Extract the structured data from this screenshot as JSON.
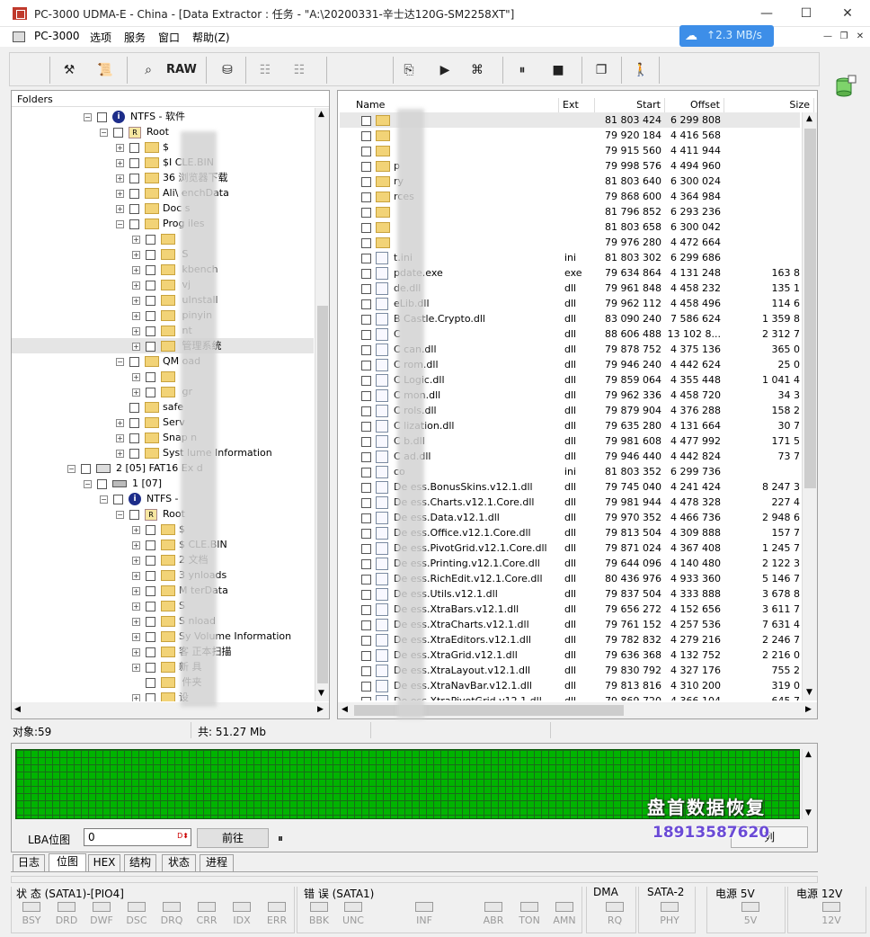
{
  "window": {
    "title": "PC-3000 UDMA-E - China - [Data Extractor : 任务 - \"A:\\20200331-辛士达120G-SM2258XT\"]",
    "net_speed": "2.3 MB/s",
    "minimize": "—",
    "maximize": "☐",
    "close": "✕"
  },
  "menu": [
    "PC-3000",
    "选项",
    "服务",
    "窗口",
    "帮助(Z)"
  ],
  "toolbar": {
    "raw_label": "RAW"
  },
  "folders": {
    "header": "Folders",
    "rows": [
      {
        "indent": 0,
        "exp": "−",
        "icon": "ntfs",
        "label": "NTFS - 软件"
      },
      {
        "indent": 1,
        "exp": "−",
        "icon": "root",
        "label": "Root"
      },
      {
        "indent": 2,
        "exp": "+",
        "icon": "folder",
        "label": "$"
      },
      {
        "indent": 2,
        "exp": "+",
        "icon": "folder",
        "label": "$I      CLE.BIN"
      },
      {
        "indent": 2,
        "exp": "+",
        "icon": "folder",
        "label": "36        浏览器下载"
      },
      {
        "indent": 2,
        "exp": "+",
        "icon": "folder",
        "label": "Ali\\         enchData"
      },
      {
        "indent": 2,
        "exp": "+",
        "icon": "folder",
        "label": "Doc          s"
      },
      {
        "indent": 2,
        "exp": "−",
        "icon": "folder",
        "label": "Prog         iles"
      },
      {
        "indent": 3,
        "exp": "+",
        "icon": "folder",
        "label": ""
      },
      {
        "indent": 3,
        "exp": "+",
        "icon": "folder",
        "label": "          S"
      },
      {
        "indent": 3,
        "exp": "+",
        "icon": "folder",
        "label": "          kbench"
      },
      {
        "indent": 3,
        "exp": "+",
        "icon": "folder",
        "label": "          vj"
      },
      {
        "indent": 3,
        "exp": "+",
        "icon": "folder",
        "label": "          uInstall"
      },
      {
        "indent": 3,
        "exp": "+",
        "icon": "folder",
        "label": "          pinyin"
      },
      {
        "indent": 3,
        "exp": "+",
        "icon": "folder",
        "label": "          nt"
      },
      {
        "indent": 3,
        "exp": "+",
        "icon": "folder",
        "label": "          管理系统",
        "selected": true
      },
      {
        "indent": 2,
        "exp": "−",
        "icon": "folder",
        "label": "QM         oad"
      },
      {
        "indent": 3,
        "exp": "+",
        "icon": "folder",
        "label": ""
      },
      {
        "indent": 3,
        "exp": "+",
        "icon": "folder",
        "label": "          gr"
      },
      {
        "indent": 2,
        "exp": "",
        "icon": "folder",
        "label": "safe"
      },
      {
        "indent": 2,
        "exp": "+",
        "icon": "folder",
        "label": "Serv"
      },
      {
        "indent": 2,
        "exp": "+",
        "icon": "folder",
        "label": "Snap         n"
      },
      {
        "indent": 2,
        "exp": "+",
        "icon": "folder",
        "label": "Syst         lume Information"
      },
      {
        "indent": -1,
        "exp": "−",
        "icon": "part",
        "label": "2 [05] FAT16 Ex          d"
      },
      {
        "indent": 0,
        "exp": "−",
        "icon": "disk",
        "label": "1 [07]"
      },
      {
        "indent": 1,
        "exp": "−",
        "icon": "ntfs",
        "label": "NTFS - "
      },
      {
        "indent": 2,
        "exp": "−",
        "icon": "root",
        "label": "Root"
      },
      {
        "indent": 3,
        "exp": "+",
        "icon": "folder",
        "label": "$          "
      },
      {
        "indent": 3,
        "exp": "+",
        "icon": "folder",
        "label": "$          CLE.BIN"
      },
      {
        "indent": 3,
        "exp": "+",
        "icon": "folder",
        "label": "2          文档"
      },
      {
        "indent": 3,
        "exp": "+",
        "icon": "folder",
        "label": "3          ynloads"
      },
      {
        "indent": 3,
        "exp": "+",
        "icon": "folder",
        "label": "M          terData"
      },
      {
        "indent": 3,
        "exp": "+",
        "icon": "folder",
        "label": "S"
      },
      {
        "indent": 3,
        "exp": "+",
        "icon": "folder",
        "label": "S          nload"
      },
      {
        "indent": 3,
        "exp": "+",
        "icon": "folder",
        "label": "Sy          Volume Information"
      },
      {
        "indent": 3,
        "exp": "+",
        "icon": "folder",
        "label": "客          正本扫描"
      },
      {
        "indent": 3,
        "exp": "+",
        "icon": "folder",
        "label": "新          具"
      },
      {
        "indent": 3,
        "exp": "",
        "icon": "folder",
        "label": "          件夹"
      },
      {
        "indent": 3,
        "exp": "+",
        "icon": "folder",
        "label": "设"
      }
    ]
  },
  "files": {
    "columns": [
      "Name",
      "Ext",
      "Start",
      "Offset",
      "Size"
    ],
    "rows": [
      {
        "type": "folder",
        "name": "",
        "ext": "",
        "start": "81 803 424",
        "offset": "6 299 808",
        "size": ""
      },
      {
        "type": "folder",
        "name": "",
        "ext": "",
        "start": "79 920 184",
        "offset": "4 416 568",
        "size": ""
      },
      {
        "type": "folder",
        "name": "",
        "ext": "",
        "start": "79 915 560",
        "offset": "4 411 944",
        "size": ""
      },
      {
        "type": "folder",
        "name": "                p",
        "ext": "",
        "start": "79 998 576",
        "offset": "4 494 960",
        "size": ""
      },
      {
        "type": "folder",
        "name": "               ry",
        "ext": "",
        "start": "81 803 640",
        "offset": "6 300 024",
        "size": ""
      },
      {
        "type": "folder",
        "name": "             rces",
        "ext": "",
        "start": "79 868 600",
        "offset": "4 364 984",
        "size": ""
      },
      {
        "type": "folder",
        "name": "",
        "ext": "",
        "start": "81 796 852",
        "offset": "6 293 236",
        "size": ""
      },
      {
        "type": "folder",
        "name": "",
        "ext": "",
        "start": "81 803 658",
        "offset": "6 300 042",
        "size": ""
      },
      {
        "type": "folder",
        "name": "",
        "ext": "",
        "start": "79 976 280",
        "offset": "4 472 664",
        "size": ""
      },
      {
        "type": "file",
        "name": "             t.ini",
        "ext": "ini",
        "start": "81 803 302",
        "offset": "6 299 686",
        "size": ""
      },
      {
        "type": "exe",
        "name": "           pdate.exe",
        "ext": "exe",
        "start": "79 634 864",
        "offset": "4 131 248",
        "size": "163 8"
      },
      {
        "type": "dll",
        "name": "            de.dll",
        "ext": "dll",
        "start": "79 961 848",
        "offset": "4 458 232",
        "size": "135 1"
      },
      {
        "type": "dll",
        "name": "            eLib.dll",
        "ext": "dll",
        "start": "79 962 112",
        "offset": "4 458 496",
        "size": "114 6"
      },
      {
        "type": "dll",
        "name": "B          Castle.Crypto.dll",
        "ext": "dll",
        "start": "83 090 240",
        "offset": "7 586 624",
        "size": "1 359 8"
      },
      {
        "type": "dll",
        "name": "C",
        "ext": "dll",
        "start": "88 606 488",
        "offset": "13 102 8...",
        "size": "2 312 7"
      },
      {
        "type": "dll",
        "name": "C          can.dll",
        "ext": "dll",
        "start": "79 878 752",
        "offset": "4 375 136",
        "size": "365 0"
      },
      {
        "type": "dll",
        "name": "C          rom.dll",
        "ext": "dll",
        "start": "79 946 240",
        "offset": "4 442 624",
        "size": "25 0"
      },
      {
        "type": "dll",
        "name": "C          Logic.dll",
        "ext": "dll",
        "start": "79 859 064",
        "offset": "4 355 448",
        "size": "1 041 4"
      },
      {
        "type": "dll",
        "name": "C          mon.dll",
        "ext": "dll",
        "start": "79 962 336",
        "offset": "4 458 720",
        "size": "34 3"
      },
      {
        "type": "dll",
        "name": "C          rols.dll",
        "ext": "dll",
        "start": "79 879 904",
        "offset": "4 376 288",
        "size": "158 2"
      },
      {
        "type": "dll",
        "name": "C          lization.dll",
        "ext": "dll",
        "start": "79 635 280",
        "offset": "4 131 664",
        "size": "30 7"
      },
      {
        "type": "dll",
        "name": "C          b.dll",
        "ext": "dll",
        "start": "79 981 608",
        "offset": "4 477 992",
        "size": "171 5"
      },
      {
        "type": "dll",
        "name": "C          ad.dll",
        "ext": "dll",
        "start": "79 946 440",
        "offset": "4 442 824",
        "size": "73 7"
      },
      {
        "type": "file",
        "name": "co",
        "ext": "ini",
        "start": "81 803 352",
        "offset": "6 299 736",
        "size": ""
      },
      {
        "type": "dll",
        "name": "De          ess.BonusSkins.v12.1.dll",
        "ext": "dll",
        "start": "79 745 040",
        "offset": "4 241 424",
        "size": "8 247 3"
      },
      {
        "type": "dll",
        "name": "De          ess.Charts.v12.1.Core.dll",
        "ext": "dll",
        "start": "79 981 944",
        "offset": "4 478 328",
        "size": "227 4"
      },
      {
        "type": "dll",
        "name": "De          ess.Data.v12.1.dll",
        "ext": "dll",
        "start": "79 970 352",
        "offset": "4 466 736",
        "size": "2 948 6"
      },
      {
        "type": "dll",
        "name": "De          ess.Office.v12.1.Core.dll",
        "ext": "dll",
        "start": "79 813 504",
        "offset": "4 309 888",
        "size": "157 7"
      },
      {
        "type": "dll",
        "name": "De          ess.PivotGrid.v12.1.Core.dll",
        "ext": "dll",
        "start": "79 871 024",
        "offset": "4 367 408",
        "size": "1 245 7"
      },
      {
        "type": "dll",
        "name": "De          ess.Printing.v12.1.Core.dll",
        "ext": "dll",
        "start": "79 644 096",
        "offset": "4 140 480",
        "size": "2 122 3"
      },
      {
        "type": "dll",
        "name": "De          ess.RichEdit.v12.1.Core.dll",
        "ext": "dll",
        "start": "80 436 976",
        "offset": "4 933 360",
        "size": "5 146 7"
      },
      {
        "type": "dll",
        "name": "De          ess.Utils.v12.1.dll",
        "ext": "dll",
        "start": "79 837 504",
        "offset": "4 333 888",
        "size": "3 678 8"
      },
      {
        "type": "dll",
        "name": "De          ess.XtraBars.v12.1.dll",
        "ext": "dll",
        "start": "79 656 272",
        "offset": "4 152 656",
        "size": "3 611 7"
      },
      {
        "type": "dll",
        "name": "De          ess.XtraCharts.v12.1.dll",
        "ext": "dll",
        "start": "79 761 152",
        "offset": "4 257 536",
        "size": "7 631 4"
      },
      {
        "type": "dll",
        "name": "De          ess.XtraEditors.v12.1.dll",
        "ext": "dll",
        "start": "79 782 832",
        "offset": "4 279 216",
        "size": "2 246 7"
      },
      {
        "type": "dll",
        "name": "De          ess.XtraGrid.v12.1.dll",
        "ext": "dll",
        "start": "79 636 368",
        "offset": "4 132 752",
        "size": "2 216 0"
      },
      {
        "type": "dll",
        "name": "De          ess.XtraLayout.v12.1.dll",
        "ext": "dll",
        "start": "79 830 792",
        "offset": "4 327 176",
        "size": "755 2"
      },
      {
        "type": "dll",
        "name": "De          ess.XtraNavBar.v12.1.dll",
        "ext": "dll",
        "start": "79 813 816",
        "offset": "4 310 200",
        "size": "319 0"
      },
      {
        "type": "dll",
        "name": "De          ess.XtraPivotGrid.v12.1.dll",
        "ext": "dll",
        "start": "79 869 720",
        "offset": "4 366 104",
        "size": "645 7"
      }
    ]
  },
  "status": {
    "objects": "对象:59",
    "total": "共: 51.27 Mb"
  },
  "lba": {
    "label": "LBA位图",
    "value": "0",
    "goto_button": "前往",
    "pause_button": "⏸",
    "list_button": "列"
  },
  "watermark": {
    "line1": "盘首数据恢复",
    "line2": "18913587620"
  },
  "tabs": [
    "日志",
    "位图",
    "HEX",
    "结构",
    "状态",
    "进程"
  ],
  "indicators": {
    "status_group": "状 态 (SATA1)-[PIO4]",
    "status_leds": [
      "BSY",
      "DRD",
      "DWF",
      "DSC",
      "DRQ",
      "CRR",
      "IDX",
      "ERR"
    ],
    "error_group": "错 误 (SATA1)",
    "error_leds": [
      "BBK",
      "UNC",
      "INF",
      "ABR",
      "TON",
      "AMN"
    ],
    "dma_group": "DMA",
    "dma_leds": [
      "RQ"
    ],
    "sata_group": "SATA-2",
    "sata_leds": [
      "PHY"
    ],
    "p5_group": "电源 5V",
    "p5_leds": [
      "5V"
    ],
    "p12_group": "电源 12V",
    "p12_leds": [
      "12V"
    ]
  },
  "colors": {
    "map_green": "#00b400",
    "net_badge": "#3d8ee8",
    "logo_red": "#c0392b"
  }
}
